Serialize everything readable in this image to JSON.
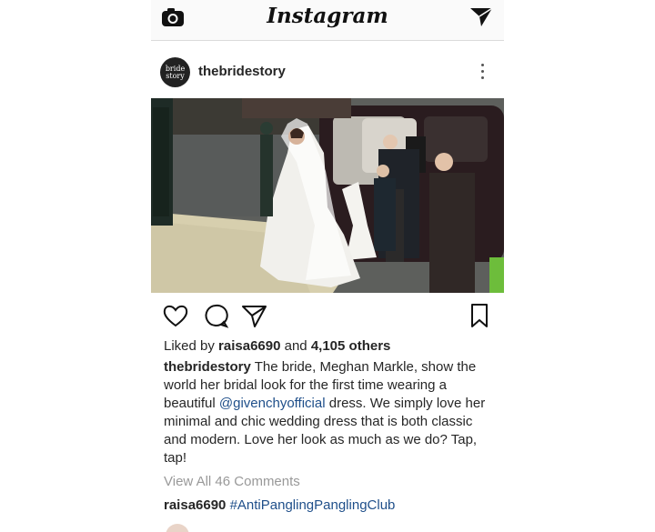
{
  "app": {
    "title": "Instagram"
  },
  "topbar": {
    "camera_icon": "camera-icon",
    "send_icon": "paper-plane-icon"
  },
  "post": {
    "avatar_text_1": "bride",
    "avatar_text_2": "story",
    "username": "thebridestory",
    "image_alt": "Bride in white gown stepping out of a vintage car",
    "likes_prefix": "Liked by",
    "likes_user": "raisa6690",
    "likes_and": "and",
    "likes_count": "4,105 others",
    "caption_user": "thebridestory",
    "caption_part1": "The bride, Meghan Markle, show the world her bridal look for the first time wearing a beautiful",
    "caption_mention": "@givenchyofficial",
    "caption_part2": "dress. We simply love her minimal and chic wedding dress that is both classic and modern. Love her look as much as we do? Tap, tap!",
    "view_comments": "View All 46 Comments",
    "comment_user": "raisa6690",
    "comment_text": "#AntiPanglingPanglingClub"
  },
  "colors": {
    "link": "#1f4f8a",
    "muted": "#999999",
    "text": "#262626"
  }
}
